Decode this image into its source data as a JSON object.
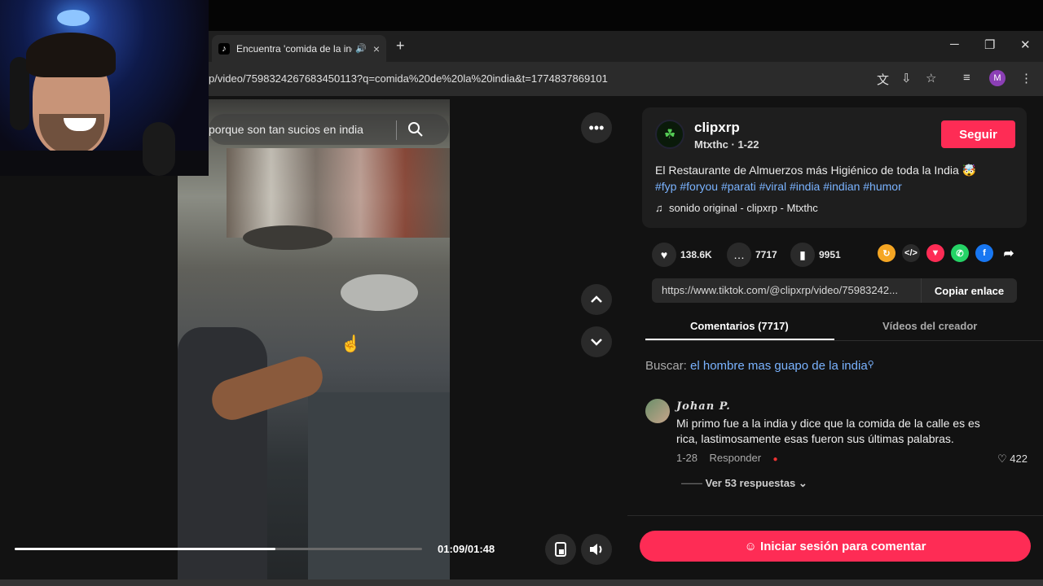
{
  "browser": {
    "tab_title": "Encuentra 'comida de la ind",
    "tab_favicon": "tiktok-icon",
    "url": "p/video/7598324267683450113?q=comida%20de%20la%20india&t=1774837869101",
    "profile_initial": "M",
    "new_tab": "+",
    "close_tab": "×"
  },
  "video": {
    "search_text": "porque son tan sucios en india",
    "time": "01:09/01:48",
    "progress_fraction": 0.64
  },
  "creator": {
    "username": "clipxrp",
    "sub": "Mtxthc · 1-22",
    "follow_label": "Seguir",
    "description": "El Restaurante de Almuerzos más Higiénico de toda la India 🤯",
    "hashtags": "#fyp #foryou #parati #viral #india #indian #humor",
    "sound": "sonido original - clipxrp - Mtxthc"
  },
  "stats": {
    "likes": "138.6K",
    "comments": "7717",
    "saves": "9951"
  },
  "share": {
    "link": "https://www.tiktok.com/@clipxrp/video/75983242...",
    "copy_label": "Copiar enlace"
  },
  "tabs": {
    "comments": "Comentarios (7717)",
    "creator_videos": "Vídeos del creador"
  },
  "search_suggest": {
    "prefix": "Buscar:",
    "query": "el hombre mas guapo de la india"
  },
  "comment": {
    "author": "Johan P.",
    "text": "Mi primo fue a la india y dice que la comida de la calle es es rica, lastimosamente esas fueron sus últimas palabras.",
    "date": "1-28",
    "reply_label": "Responder",
    "likes": "422",
    "replies": "Ver 53 respuestas"
  },
  "login_label": "Iniciar sesión para comentar",
  "colors": {
    "accent": "#fe2c55",
    "hashtag": "#7ab3ff"
  }
}
